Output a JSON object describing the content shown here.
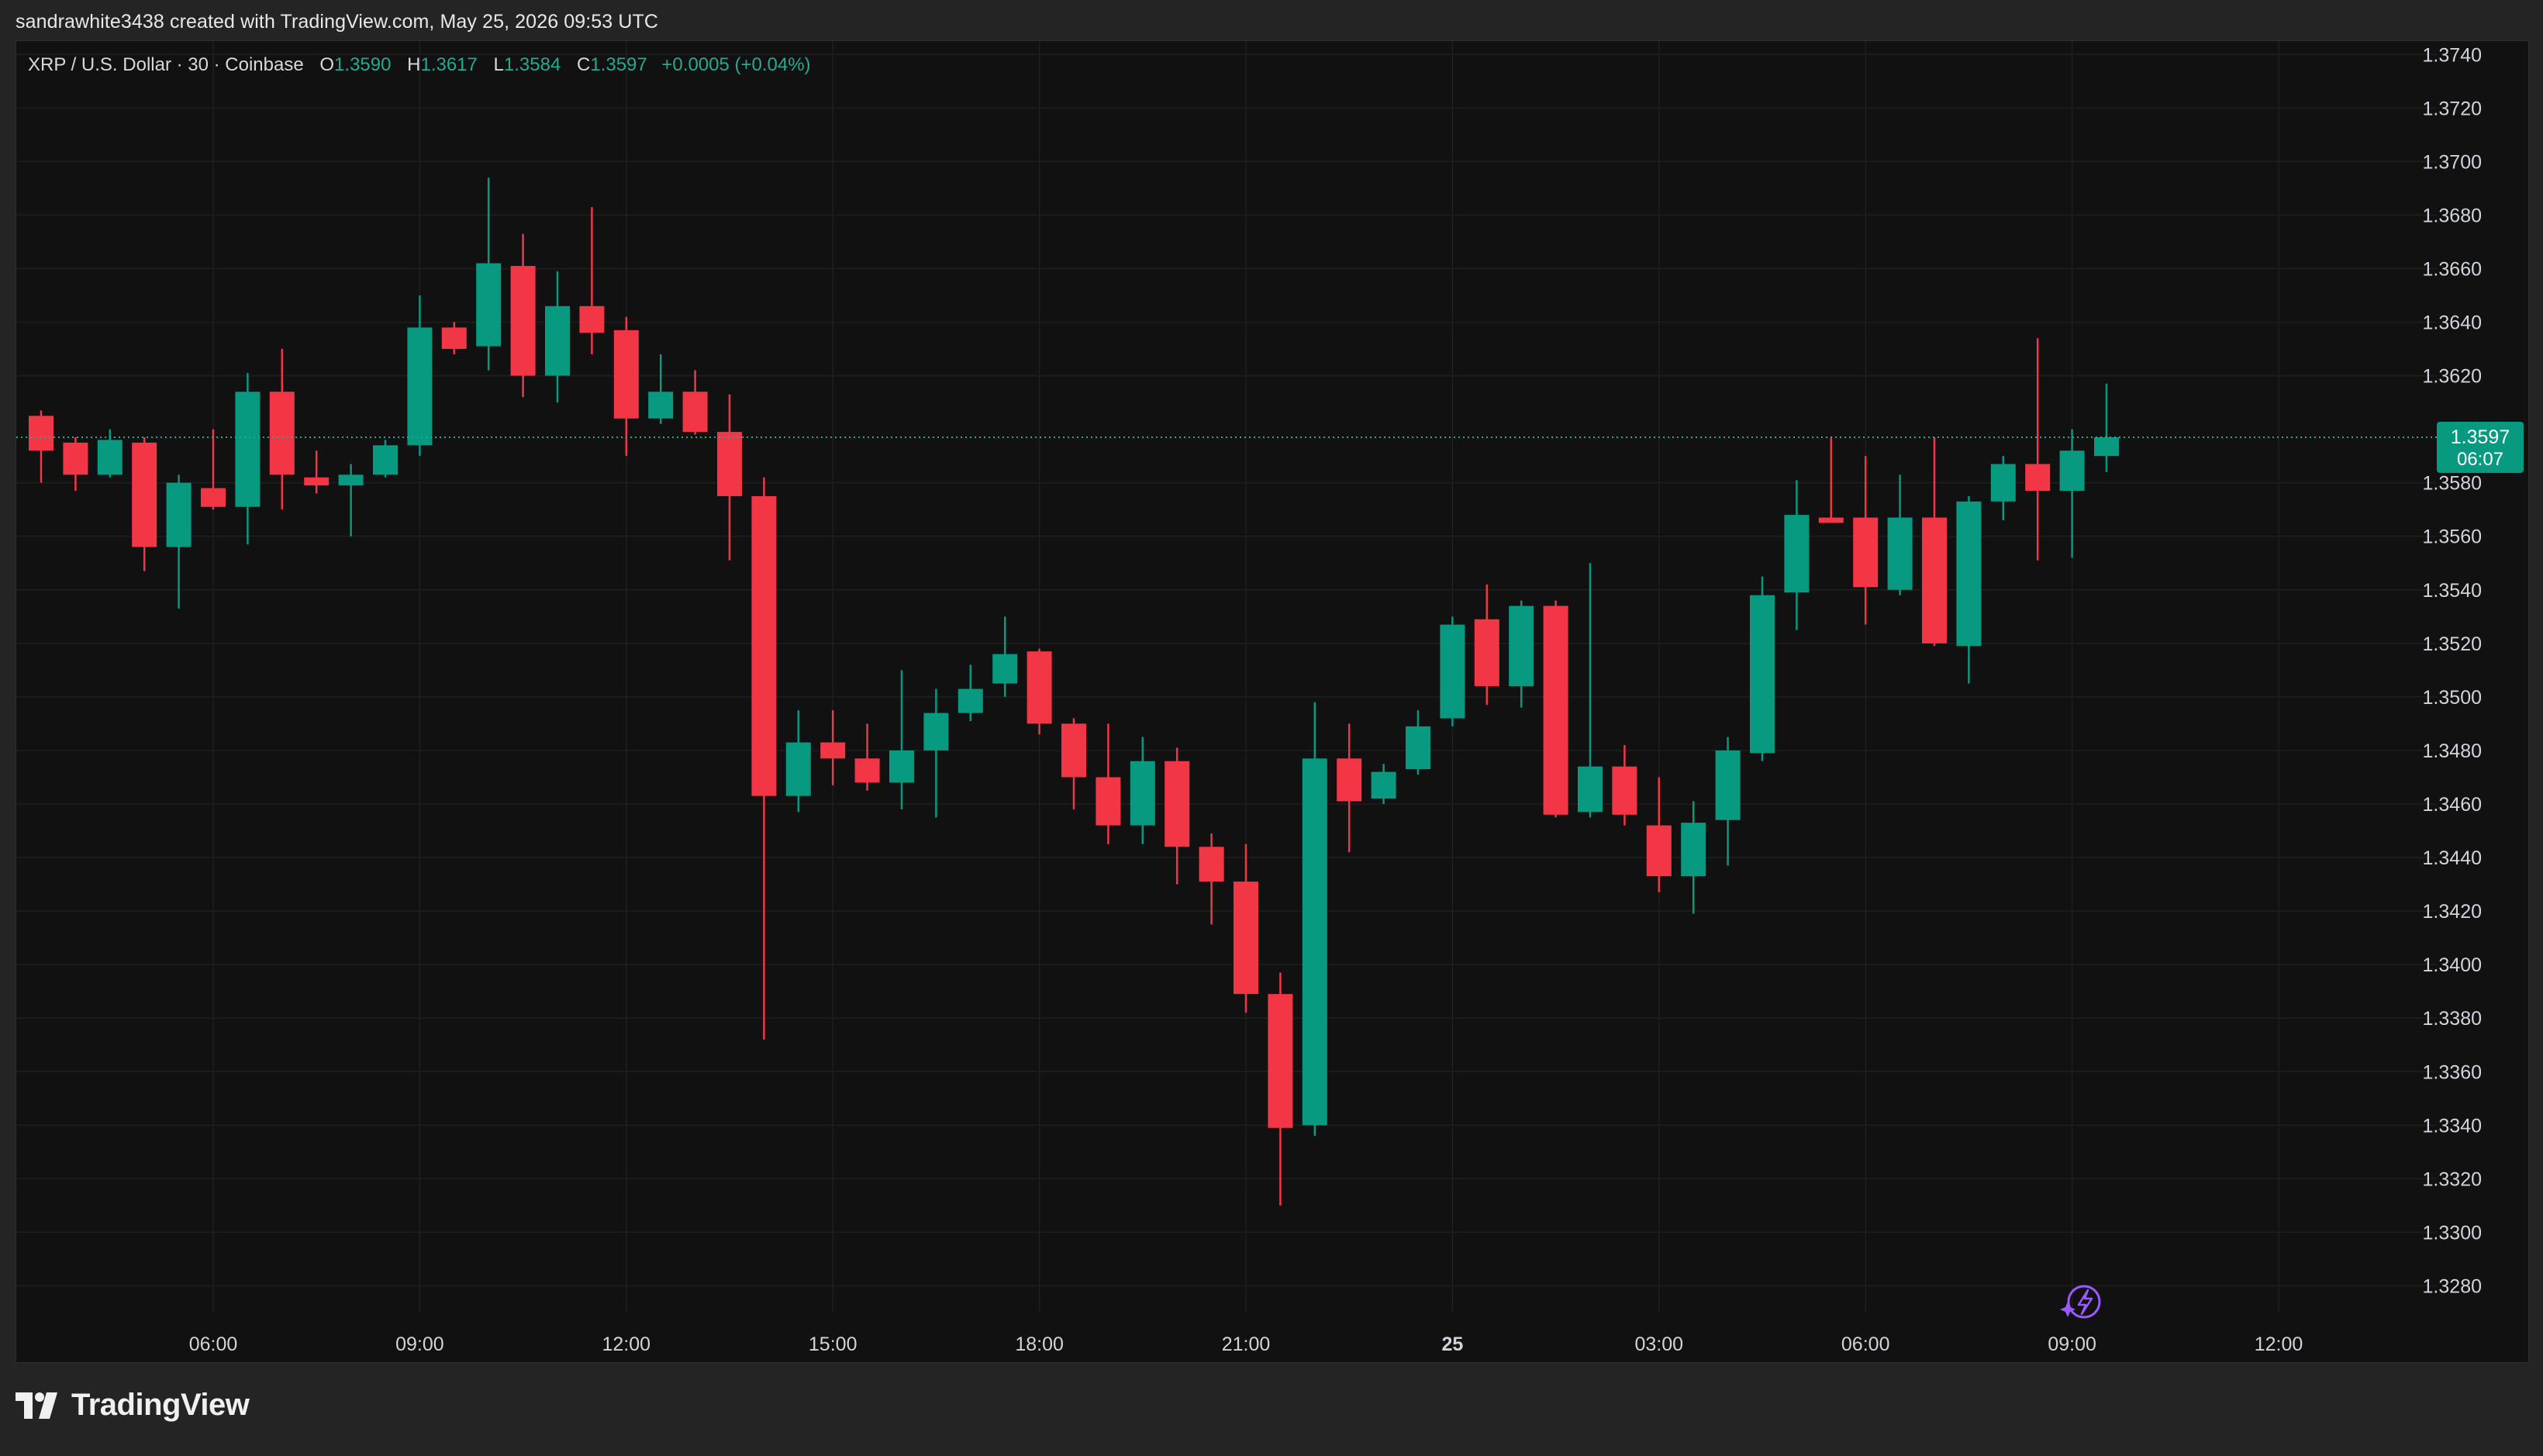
{
  "header": {
    "caption": "sandrawhite3438 created with TradingView.com, May 25, 2026 09:53 UTC"
  },
  "legend": {
    "symbol": "XRP / U.S. Dollar · 30 · Coinbase",
    "open_label": "O",
    "open": "1.3590",
    "high_label": "H",
    "high": "1.3617",
    "low_label": "L",
    "low": "1.3584",
    "close_label": "C",
    "close": "1.3597",
    "change": "+0.0005 (+0.04%)"
  },
  "price_tag": {
    "price": "1.3597",
    "countdown": "06:07"
  },
  "footer": {
    "brand": "TradingView"
  },
  "colors": {
    "up": "#089981",
    "down": "#f23645",
    "background": "#111111",
    "grid": "#1f1f1f",
    "axis_text": "#d1d4dc",
    "price_line": "#22ab94",
    "spark_icon": "#9b59ff"
  },
  "icons": [
    "tradingview-logo-icon",
    "spark-icon"
  ],
  "chart_data": {
    "type": "candlestick",
    "timeframe": "30",
    "ylim": [
      1.327,
      1.3745
    ],
    "y_ticks": [
      "1.3280",
      "1.3300",
      "1.3320",
      "1.3340",
      "1.3360",
      "1.3380",
      "1.3400",
      "1.3420",
      "1.3440",
      "1.3460",
      "1.3480",
      "1.3500",
      "1.3520",
      "1.3540",
      "1.3560",
      "1.3580",
      "1.3620",
      "1.3640",
      "1.3660",
      "1.3680",
      "1.3700",
      "1.3720",
      "1.3740"
    ],
    "x_ticks": [
      {
        "label": "06:00",
        "index": 5,
        "bold": false
      },
      {
        "label": "09:00",
        "index": 11,
        "bold": false
      },
      {
        "label": "12:00",
        "index": 17,
        "bold": false
      },
      {
        "label": "15:00",
        "index": 23,
        "bold": false
      },
      {
        "label": "18:00",
        "index": 29,
        "bold": false
      },
      {
        "label": "21:00",
        "index": 35,
        "bold": false
      },
      {
        "label": "25",
        "index": 41,
        "bold": true
      },
      {
        "label": "03:00",
        "index": 47,
        "bold": false
      },
      {
        "label": "06:00",
        "index": 53,
        "bold": false
      },
      {
        "label": "09:00",
        "index": 59,
        "bold": false
      },
      {
        "label": "12:00",
        "index": 65,
        "bold": false
      }
    ],
    "last_price": 1.3597,
    "candles": [
      {
        "o": 1.3605,
        "h": 1.3607,
        "l": 1.358,
        "c": 1.3592
      },
      {
        "o": 1.3595,
        "h": 1.3597,
        "l": 1.3577,
        "c": 1.3583
      },
      {
        "o": 1.3583,
        "h": 1.36,
        "l": 1.3582,
        "c": 1.3596
      },
      {
        "o": 1.3595,
        "h": 1.3597,
        "l": 1.3547,
        "c": 1.3556
      },
      {
        "o": 1.3556,
        "h": 1.3583,
        "l": 1.3533,
        "c": 1.358
      },
      {
        "o": 1.3578,
        "h": 1.36,
        "l": 1.357,
        "c": 1.3571
      },
      {
        "o": 1.3571,
        "h": 1.3621,
        "l": 1.3557,
        "c": 1.3614
      },
      {
        "o": 1.3614,
        "h": 1.363,
        "l": 1.357,
        "c": 1.3583
      },
      {
        "o": 1.3582,
        "h": 1.3592,
        "l": 1.3576,
        "c": 1.3579
      },
      {
        "o": 1.3579,
        "h": 1.3587,
        "l": 1.356,
        "c": 1.3583
      },
      {
        "o": 1.3583,
        "h": 1.3596,
        "l": 1.3582,
        "c": 1.3594
      },
      {
        "o": 1.3594,
        "h": 1.365,
        "l": 1.359,
        "c": 1.3638
      },
      {
        "o": 1.3638,
        "h": 1.364,
        "l": 1.3628,
        "c": 1.363
      },
      {
        "o": 1.3631,
        "h": 1.3694,
        "l": 1.3622,
        "c": 1.3662
      },
      {
        "o": 1.3661,
        "h": 1.3673,
        "l": 1.3612,
        "c": 1.362
      },
      {
        "o": 1.362,
        "h": 1.3659,
        "l": 1.361,
        "c": 1.3646
      },
      {
        "o": 1.3646,
        "h": 1.3683,
        "l": 1.3628,
        "c": 1.3636
      },
      {
        "o": 1.3637,
        "h": 1.3642,
        "l": 1.359,
        "c": 1.3604
      },
      {
        "o": 1.3604,
        "h": 1.3628,
        "l": 1.3602,
        "c": 1.3614
      },
      {
        "o": 1.3614,
        "h": 1.3622,
        "l": 1.3598,
        "c": 1.3599
      },
      {
        "o": 1.3599,
        "h": 1.3613,
        "l": 1.3551,
        "c": 1.3575
      },
      {
        "o": 1.3575,
        "h": 1.3582,
        "l": 1.3372,
        "c": 1.3463
      },
      {
        "o": 1.3463,
        "h": 1.3495,
        "l": 1.3457,
        "c": 1.3483
      },
      {
        "o": 1.3483,
        "h": 1.3495,
        "l": 1.3467,
        "c": 1.3477
      },
      {
        "o": 1.3477,
        "h": 1.349,
        "l": 1.3465,
        "c": 1.3468
      },
      {
        "o": 1.3468,
        "h": 1.351,
        "l": 1.3458,
        "c": 1.348
      },
      {
        "o": 1.348,
        "h": 1.3503,
        "l": 1.3455,
        "c": 1.3494
      },
      {
        "o": 1.3494,
        "h": 1.3512,
        "l": 1.3491,
        "c": 1.3503
      },
      {
        "o": 1.3505,
        "h": 1.353,
        "l": 1.35,
        "c": 1.3516
      },
      {
        "o": 1.3517,
        "h": 1.3518,
        "l": 1.3486,
        "c": 1.349
      },
      {
        "o": 1.349,
        "h": 1.3492,
        "l": 1.3458,
        "c": 1.347
      },
      {
        "o": 1.347,
        "h": 1.349,
        "l": 1.3445,
        "c": 1.3452
      },
      {
        "o": 1.3452,
        "h": 1.3485,
        "l": 1.3445,
        "c": 1.3476
      },
      {
        "o": 1.3476,
        "h": 1.3481,
        "l": 1.343,
        "c": 1.3444
      },
      {
        "o": 1.3444,
        "h": 1.3449,
        "l": 1.3415,
        "c": 1.3431
      },
      {
        "o": 1.3431,
        "h": 1.3445,
        "l": 1.3382,
        "c": 1.3389
      },
      {
        "o": 1.3389,
        "h": 1.3397,
        "l": 1.331,
        "c": 1.3339
      },
      {
        "o": 1.334,
        "h": 1.3498,
        "l": 1.3336,
        "c": 1.3477
      },
      {
        "o": 1.3477,
        "h": 1.349,
        "l": 1.3442,
        "c": 1.3461
      },
      {
        "o": 1.3462,
        "h": 1.3475,
        "l": 1.346,
        "c": 1.3472
      },
      {
        "o": 1.3473,
        "h": 1.3495,
        "l": 1.3471,
        "c": 1.3489
      },
      {
        "o": 1.3492,
        "h": 1.353,
        "l": 1.3489,
        "c": 1.3527
      },
      {
        "o": 1.3529,
        "h": 1.3542,
        "l": 1.3497,
        "c": 1.3504
      },
      {
        "o": 1.3504,
        "h": 1.3536,
        "l": 1.3496,
        "c": 1.3534
      },
      {
        "o": 1.3534,
        "h": 1.3536,
        "l": 1.3455,
        "c": 1.3456
      },
      {
        "o": 1.3457,
        "h": 1.355,
        "l": 1.3455,
        "c": 1.3474
      },
      {
        "o": 1.3474,
        "h": 1.3482,
        "l": 1.3452,
        "c": 1.3456
      },
      {
        "o": 1.3452,
        "h": 1.347,
        "l": 1.3427,
        "c": 1.3433
      },
      {
        "o": 1.3433,
        "h": 1.3461,
        "l": 1.3419,
        "c": 1.3453
      },
      {
        "o": 1.3454,
        "h": 1.3485,
        "l": 1.3437,
        "c": 1.348
      },
      {
        "o": 1.3479,
        "h": 1.3545,
        "l": 1.3476,
        "c": 1.3538
      },
      {
        "o": 1.3539,
        "h": 1.3581,
        "l": 1.3525,
        "c": 1.3568
      },
      {
        "o": 1.3567,
        "h": 1.3597,
        "l": 1.3566,
        "c": 1.3565
      },
      {
        "o": 1.3567,
        "h": 1.359,
        "l": 1.3527,
        "c": 1.3541
      },
      {
        "o": 1.354,
        "h": 1.3583,
        "l": 1.3538,
        "c": 1.3567
      },
      {
        "o": 1.3567,
        "h": 1.3597,
        "l": 1.3519,
        "c": 1.352
      },
      {
        "o": 1.3519,
        "h": 1.3575,
        "l": 1.3505,
        "c": 1.3573
      },
      {
        "o": 1.3573,
        "h": 1.359,
        "l": 1.3566,
        "c": 1.3587
      },
      {
        "o": 1.3587,
        "h": 1.3634,
        "l": 1.3551,
        "c": 1.3577
      },
      {
        "o": 1.3577,
        "h": 1.36,
        "l": 1.3552,
        "c": 1.3592
      },
      {
        "o": 1.359,
        "h": 1.3617,
        "l": 1.3584,
        "c": 1.3597
      }
    ]
  }
}
